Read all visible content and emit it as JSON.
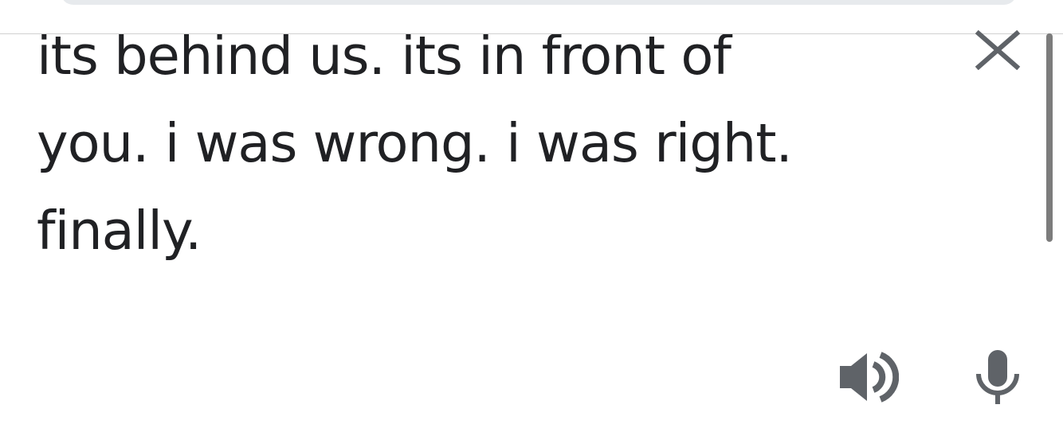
{
  "input": {
    "text": "its behind us. its in front of\nyou. i was wrong. i was right.\nfinally."
  },
  "icons": {
    "clear": "close-icon",
    "listen": "speaker-icon",
    "voice": "microphone-icon"
  },
  "colors": {
    "text": "#202124",
    "icon": "#5f6368",
    "scrollbar": "#7c7c7c",
    "top_pill": "#e7eaed"
  }
}
